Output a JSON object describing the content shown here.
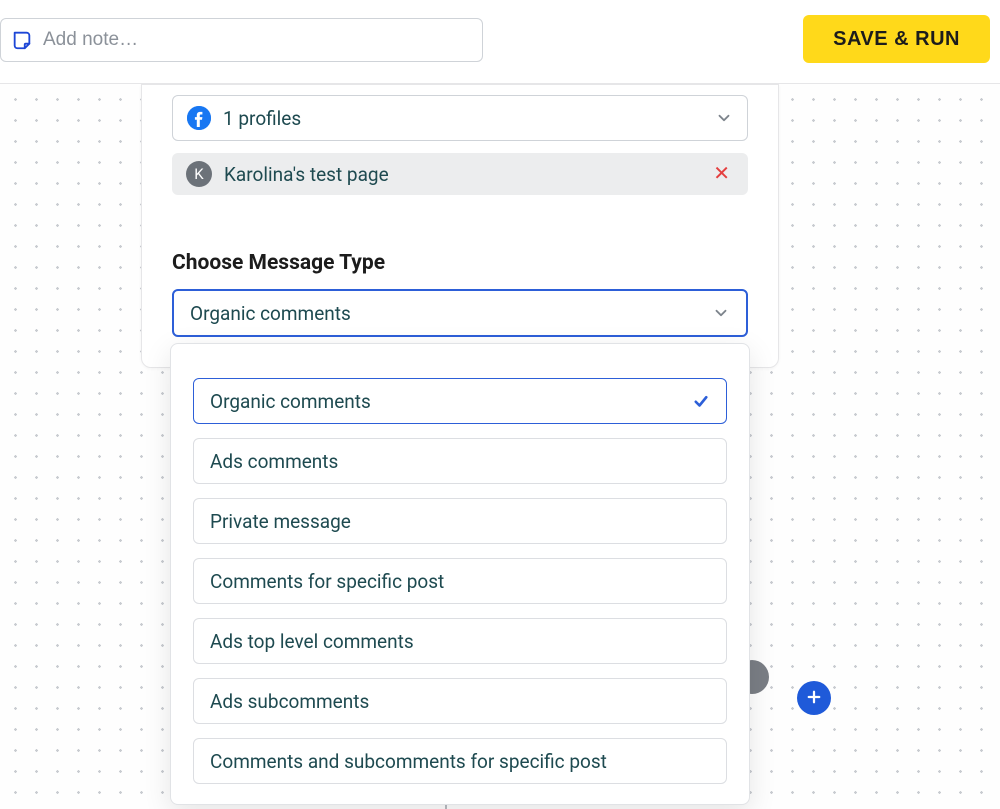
{
  "topbar": {
    "note_placeholder": "Add note…",
    "save_run_label": "SAVE & RUN"
  },
  "profiles": {
    "count_label": "1 profiles",
    "items": [
      {
        "initial": "K",
        "name": "Karolina's test page"
      }
    ]
  },
  "message_type": {
    "heading": "Choose Message Type",
    "selected": "Organic comments",
    "options": [
      "Organic comments",
      "Ads comments",
      "Private message",
      "Comments for specific post",
      "Ads top level comments",
      "Ads subcomments",
      "Comments and subcomments for specific post"
    ]
  }
}
